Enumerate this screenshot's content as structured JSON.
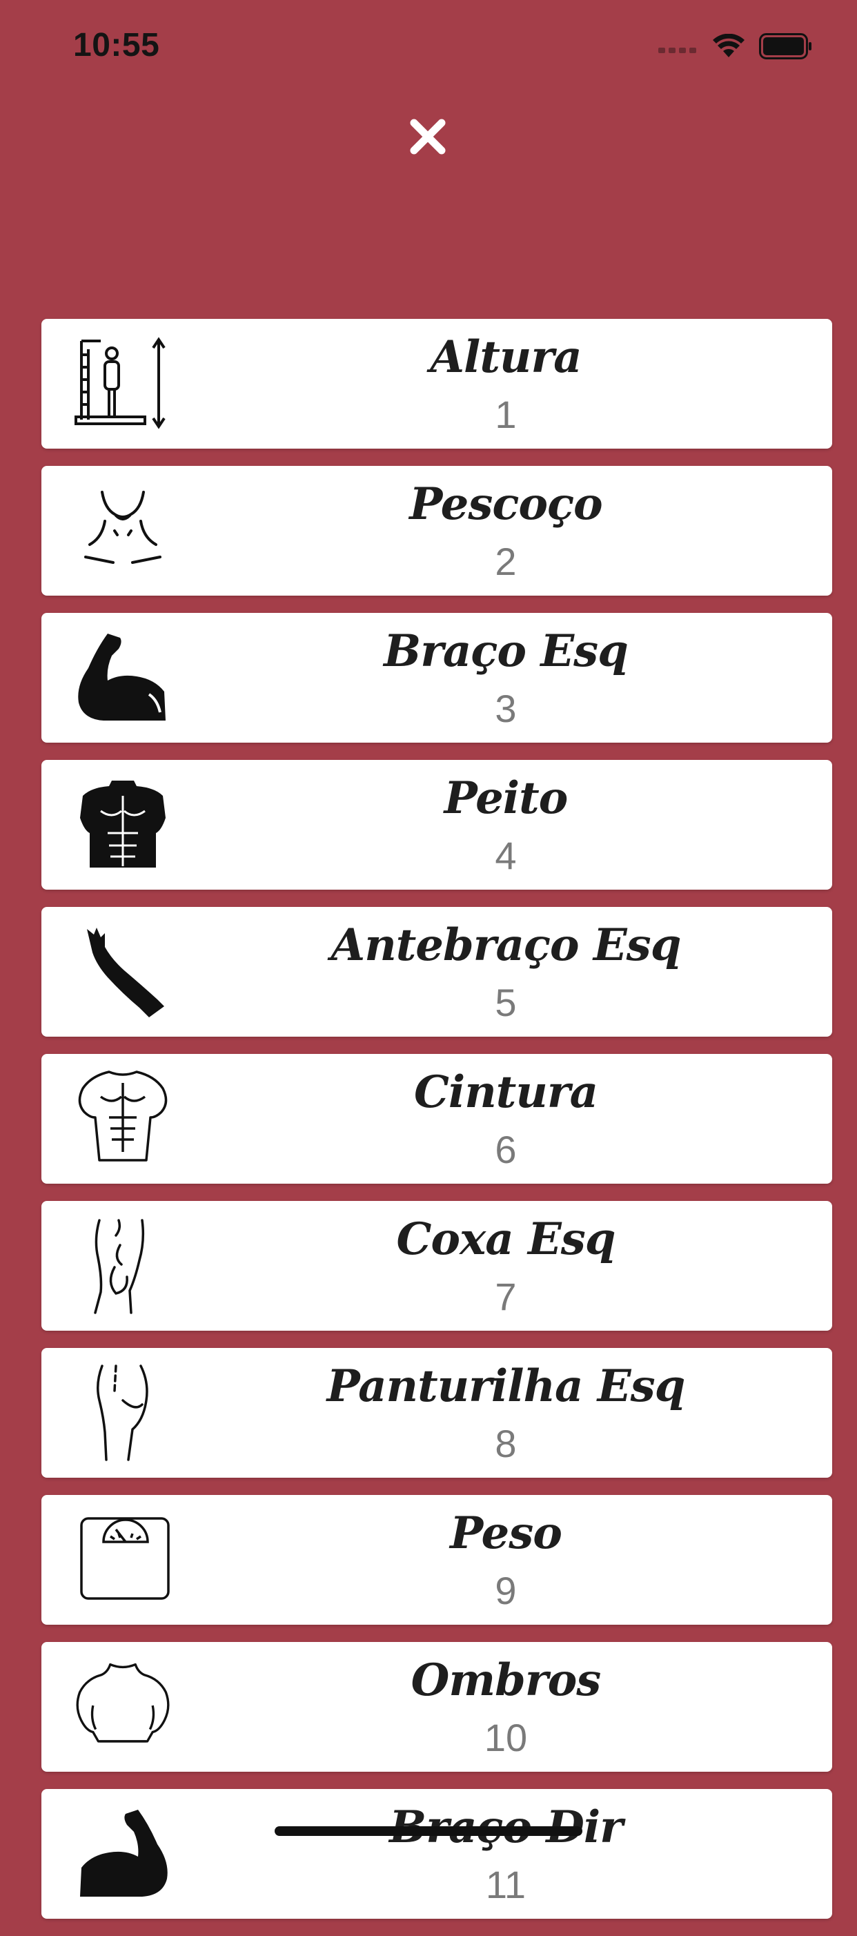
{
  "status_bar": {
    "time": "10:55"
  },
  "header": {
    "close_icon": "close-x-icon"
  },
  "measurements": [
    {
      "title": "Altura",
      "number": "1",
      "icon": "height-ruler-icon"
    },
    {
      "title": "Pescoço",
      "number": "2",
      "icon": "neck-icon"
    },
    {
      "title": "Braço Esq",
      "number": "3",
      "icon": "flexed-arm-icon"
    },
    {
      "title": "Peito",
      "number": "4",
      "icon": "chest-icon"
    },
    {
      "title": "Antebraço Esq",
      "number": "5",
      "icon": "forearm-icon"
    },
    {
      "title": "Cintura",
      "number": "6",
      "icon": "waist-torso-icon"
    },
    {
      "title": "Coxa Esq",
      "number": "7",
      "icon": "thigh-icon"
    },
    {
      "title": "Panturilha Esq",
      "number": "8",
      "icon": "calf-icon"
    },
    {
      "title": "Peso",
      "number": "9",
      "icon": "scale-icon"
    },
    {
      "title": "Ombros",
      "number": "10",
      "icon": "shoulders-icon"
    },
    {
      "title": "Braço Dir",
      "number": "11",
      "icon": "flexed-arm-icon"
    }
  ],
  "colors": {
    "background": "#a43e49",
    "card": "#ffffff",
    "title": "#1e1e1e",
    "number": "#7a7a7a"
  }
}
